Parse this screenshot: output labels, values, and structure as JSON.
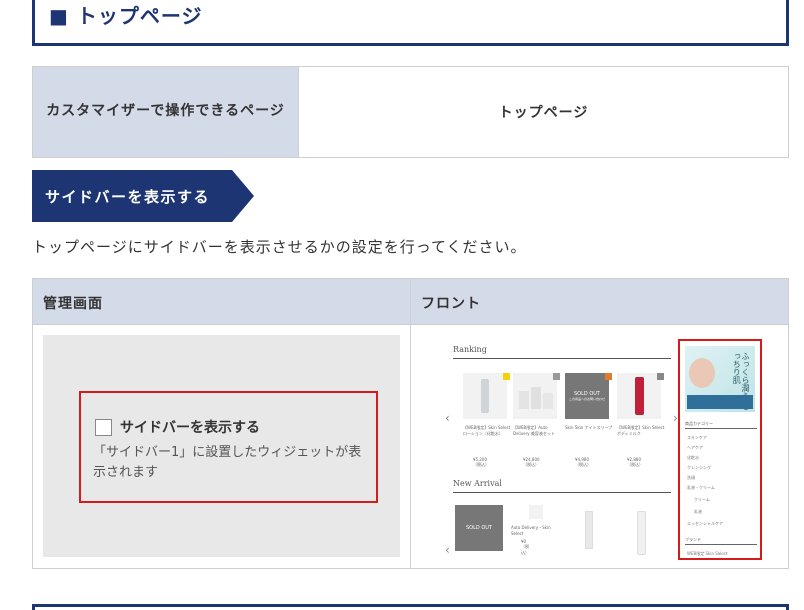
{
  "page_heading": "■ トップページ",
  "table1": {
    "header": "カスタマイザーで操作できるページ",
    "value": "トップページ"
  },
  "section_tag": "サイドバーを表示する",
  "description": "トップページにサイドバーを表示させるかの設定を行ってください。",
  "table2": {
    "col1_header": "管理画面",
    "col2_header": "フロント",
    "admin_preview": {
      "checkbox_label": "サイドバーを表示する",
      "checkbox_description": "「サイドバー1」に設置したウィジェットが表示されます",
      "checked": false
    },
    "front_preview": {
      "ranking_title": "Ranking",
      "new_arrival_title": "New Arrival",
      "sold_out": "SOLD OUT",
      "sold_out_sub": "この商品へのお問い合わせ",
      "products": [
        {
          "caption": "【WEB限定】Skin Select ローション（化粧水）",
          "price": "¥5,200（税込）"
        },
        {
          "caption": "【WEB限定】Auto Delivery 美容液セット",
          "price": "¥24,800（税込）"
        },
        {
          "caption": "Skin Skin ナイトスリープ",
          "price": "¥4,980（税込）"
        },
        {
          "caption": "【WEB限定】Skin Select ボディミルク",
          "price": "¥2,880（税込）"
        }
      ],
      "new_products": [
        {
          "caption": "Auto Delivery・Skin Select",
          "price": "¥0（税込）"
        }
      ],
      "sidebar": {
        "banner_text": "ふっくら潤う もっちり肌",
        "category_title": "商品カテゴリー",
        "categories": [
          "スキンケア",
          "ヘアケア",
          "化粧水",
          "クレンジング",
          "洗顔",
          "乳液・クリーム",
          "クリーム",
          "乳液",
          "エッセンシャルケア"
        ],
        "brand_title": "ブランド",
        "brands": [
          "WEB限定 Skin Select"
        ]
      }
    }
  },
  "colors": {
    "navy": "#1d3572",
    "header_bg": "#d3dae8",
    "highlight_red": "#d61b1b",
    "admin_bg": "#e8e8e8"
  }
}
